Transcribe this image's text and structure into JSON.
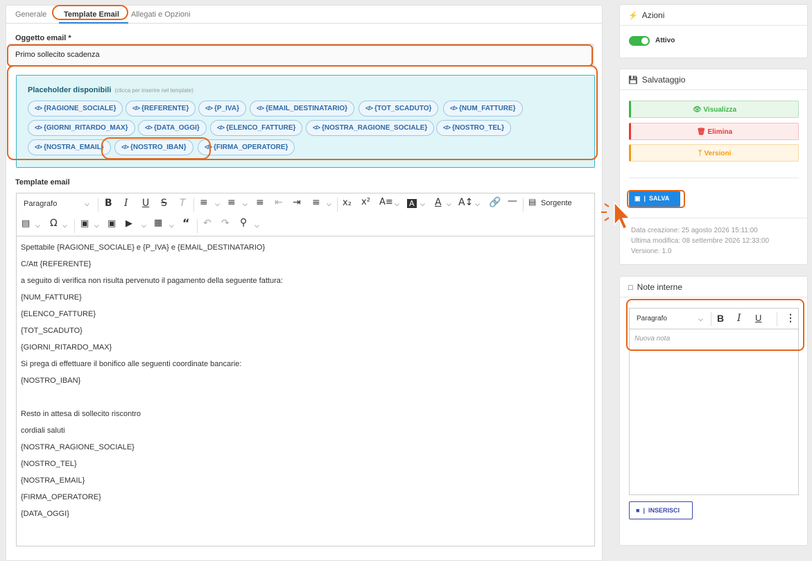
{
  "tabs": [
    "Generale",
    "Template Email",
    "Allegati e Opzioni"
  ],
  "subject": {
    "label": "Oggetto email *",
    "value": "Primo sollecito scadenza"
  },
  "placeholders": {
    "title": "Placeholder disponibili",
    "hint": "(clicca per inserire nel template)",
    "chips": [
      "{RAGIONE_SOCIALE}",
      "{REFERENTE}",
      "{P_IVA}",
      "{EMAIL_DESTINATARIO}",
      "{TOT_SCADUTO}",
      "{NUM_FATTURE}",
      "{GIORNI_RITARDO_MAX}",
      "{DATA_OGGI}",
      "{ELENCO_FATTURE}",
      "{NOSTRA_RAGIONE_SOCIALE}",
      "{NOSTRO_TEL}",
      "{NOSTRA_EMAIL}",
      "{NOSTRO_IBAN}",
      "{FIRMA_OPERATORE}"
    ]
  },
  "template": {
    "label": "Template email",
    "paragraph_select": "Paragrafo",
    "source_label": "Sorgente",
    "lines": [
      "Spettabile {RAGIONE_SOCIALE} e {P_IVA} e {EMAIL_DESTINATARIO}",
      "C/Att {REFERENTE}",
      "a seguito di verifica non risulta pervenuto il pagamento della seguente fattura:",
      "{NUM_FATTURE}",
      "{ELENCO_FATTURE}",
      "{TOT_SCADUTO}",
      "{GIORNI_RITARDO_MAX}",
      "Si prega di effettuare il bonifico alle seguenti coordinate bancarie:",
      "{NOSTRO_IBAN}",
      "",
      "Resto in attesa di sollecito riscontro",
      "cordiali saluti",
      "{NOSTRA_RAGIONE_SOCIALE}",
      "{NOSTRO_TEL}",
      "{NOSTRA_EMAIL}",
      "{FIRMA_OPERATORE}",
      "{DATA_OGGI}"
    ]
  },
  "actions": {
    "title": "Azioni",
    "toggle_label": "Attivo",
    "toggle_on": true,
    "toggle_color": "#3cb54a"
  },
  "save": {
    "title": "Salvataggio",
    "view_label": "Visualizza",
    "delete_label": "Elimina",
    "versions_label": "Versioni",
    "save_label": "SALVA",
    "created": "Data creazione: 25 agosto 2026 15:11:00",
    "modified": "Ultima modifica: 08 settembre 2026 12:33:00",
    "version": "Versione: 1.0"
  },
  "notes": {
    "title": "Note interne",
    "paragraph_select": "Paragrafo",
    "placeholder": "Nuova nota",
    "insert_label": "INSERISCI"
  },
  "colors": {
    "accent": "#2b7fd6",
    "highlight": "#e5651c",
    "placeholder_bg": "#dff5f7"
  }
}
